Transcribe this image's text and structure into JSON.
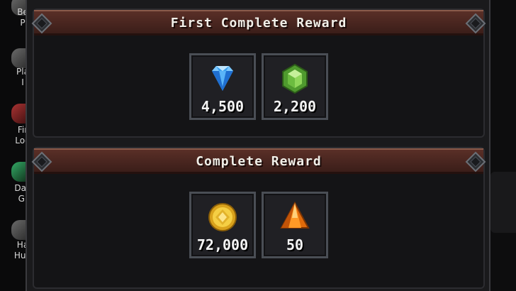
{
  "sidebar": {
    "items": [
      {
        "label": "Be\nP",
        "icon": "gray-emblem-icon"
      },
      {
        "label": "Pla\nI",
        "icon": "gray-emblem-icon"
      },
      {
        "label": "Fir\nLog",
        "icon": "red-emblem-icon"
      },
      {
        "label": "Dail\nGi",
        "icon": "green-emblem-icon"
      },
      {
        "label": "Ha\nHun",
        "icon": "gray-emblem-icon"
      }
    ]
  },
  "sections": [
    {
      "title": "First Complete Reward",
      "rewards": [
        {
          "icon": "blue-diamond-icon",
          "amount": "4,500"
        },
        {
          "icon": "green-gem-icon",
          "amount": "2,200"
        }
      ]
    },
    {
      "title": "Complete Reward",
      "rewards": [
        {
          "icon": "gold-coin-icon",
          "amount": "72,000"
        },
        {
          "icon": "orange-crystal-icon",
          "amount": "50"
        }
      ]
    }
  ],
  "colors": {
    "banner": "#4a2620",
    "slot_border": "#4a4e55",
    "text": "#f5f5f5"
  }
}
